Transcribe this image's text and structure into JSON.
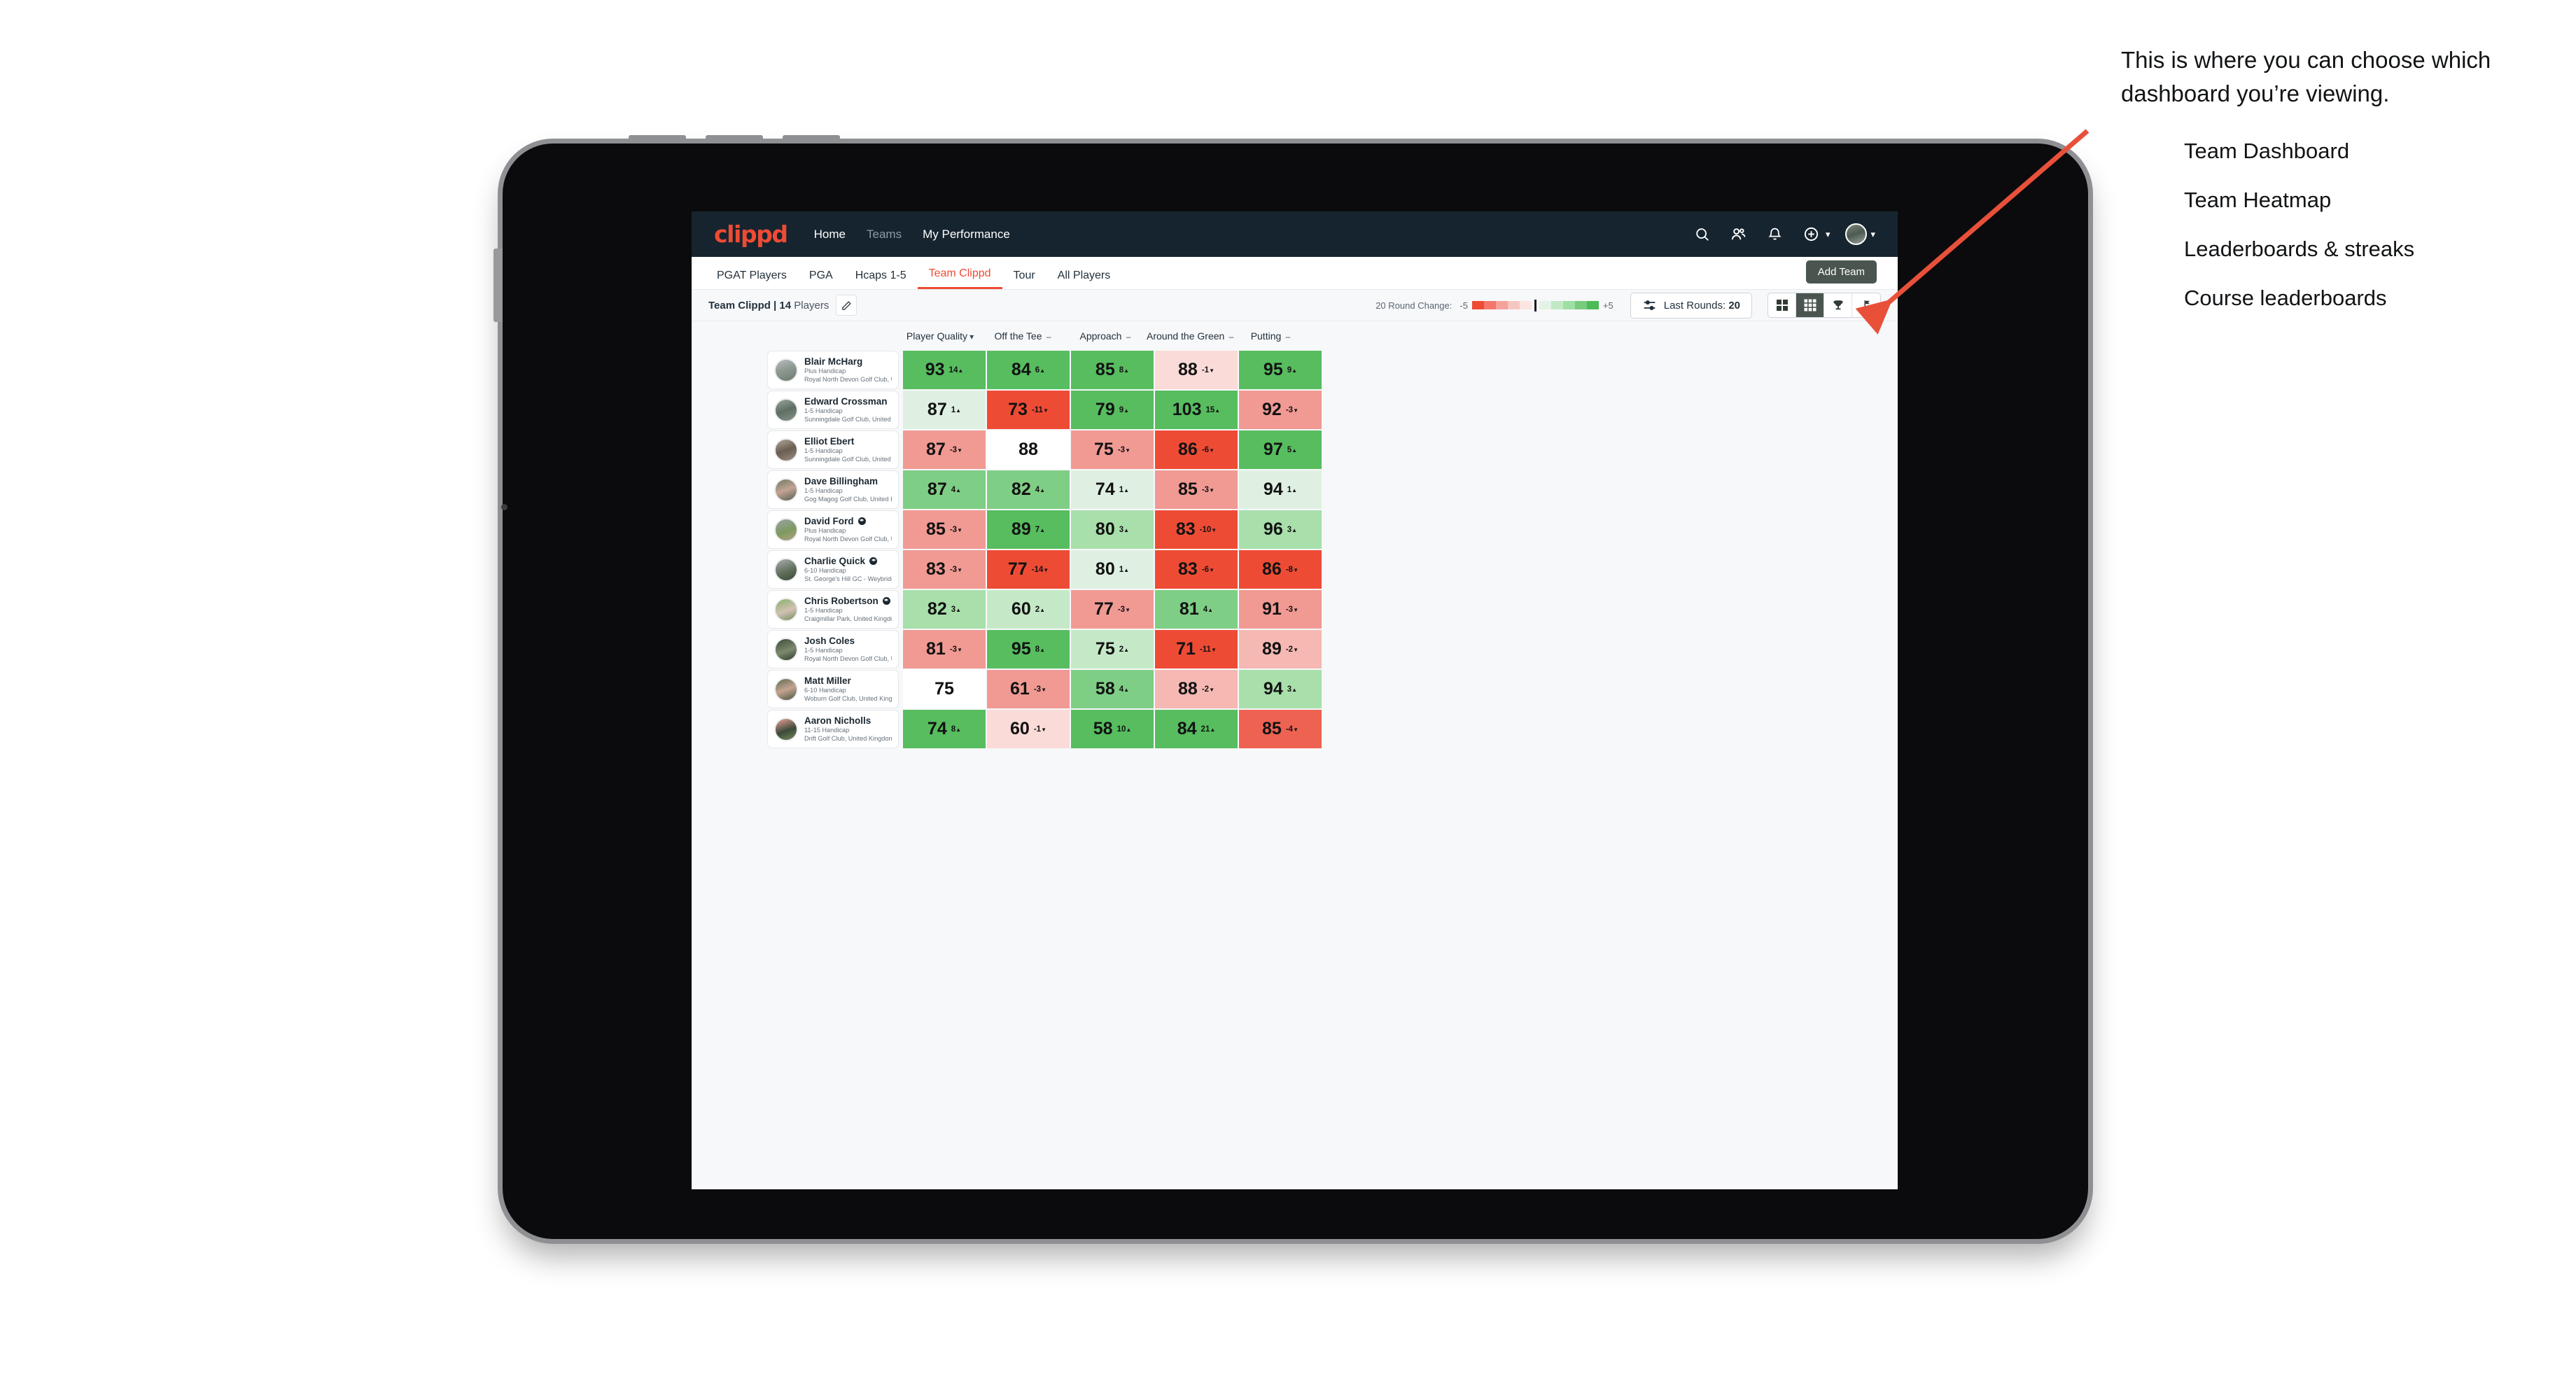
{
  "topnav": {
    "brand": "clippd",
    "links": [
      {
        "label": "Home",
        "muted": false
      },
      {
        "label": "Teams",
        "muted": true
      },
      {
        "label": "My Performance",
        "muted": false
      }
    ],
    "icons": [
      "search-icon",
      "people-icon",
      "bell-icon",
      "plus-circle-icon"
    ]
  },
  "tabs": [
    {
      "label": "PGAT Players",
      "active": false
    },
    {
      "label": "PGA",
      "active": false
    },
    {
      "label": "Hcaps 1-5",
      "active": false
    },
    {
      "label": "Team Clippd",
      "active": true
    },
    {
      "label": "Tour",
      "active": false
    },
    {
      "label": "All Players",
      "active": false
    }
  ],
  "add_team_label": "Add Team",
  "toolbar": {
    "team_name": "Team Clippd | 14",
    "team_players_word": "Players",
    "legend_label": "20 Round Change:",
    "legend_min": "-5",
    "legend_max": "+5",
    "last_rounds_prefix": "Last Rounds:",
    "last_rounds_value": "20",
    "view_buttons": [
      {
        "name": "grid-4-view",
        "active": false
      },
      {
        "name": "grid-9-view",
        "active": true
      },
      {
        "name": "trophy-view",
        "active": false
      },
      {
        "name": "golf-flag-view",
        "active": false
      }
    ]
  },
  "columns": [
    {
      "label": "Player Quality",
      "marker": "⌄"
    },
    {
      "label": "Off the Tee",
      "marker": "–"
    },
    {
      "label": "Approach",
      "marker": "–"
    },
    {
      "label": "Around the Green",
      "marker": "–"
    },
    {
      "label": "Putting",
      "marker": "–"
    }
  ],
  "colors": {
    "brand": "#ee4b35",
    "navy": "#16242f",
    "dark_green": "#4b554f",
    "strong_green": "#57bd5f",
    "strong_red": "#ee4b35",
    "annotation_arrow": "#e8503a"
  },
  "chart_data": {
    "type": "heatmap",
    "title": "Team Clippd | 14 Players",
    "columns": [
      "Player Quality",
      "Off the Tee",
      "Approach",
      "Around the Green",
      "Putting"
    ],
    "rows": [
      "Blair McHarg",
      "Edward Crossman",
      "Elliot Ebert",
      "Dave Billingham",
      "David Ford",
      "Charlie Quick",
      "Chris Robertson",
      "Josh Coles",
      "Matt Miller",
      "Aaron Nicholls"
    ],
    "legend": {
      "label": "20 Round Change:",
      "min": -5,
      "max": 5
    },
    "values": [
      [
        93,
        84,
        85,
        88,
        95
      ],
      [
        87,
        73,
        79,
        103,
        92
      ],
      [
        87,
        88,
        75,
        86,
        97
      ],
      [
        87,
        82,
        74,
        85,
        94
      ],
      [
        85,
        89,
        80,
        83,
        96
      ],
      [
        83,
        77,
        80,
        83,
        86
      ],
      [
        82,
        60,
        77,
        81,
        91
      ],
      [
        81,
        95,
        75,
        71,
        89
      ],
      [
        75,
        61,
        58,
        88,
        94
      ],
      [
        74,
        60,
        58,
        84,
        85
      ]
    ],
    "deltas": [
      [
        14,
        6,
        8,
        -1,
        9
      ],
      [
        1,
        -11,
        9,
        15,
        -3
      ],
      [
        -3,
        null,
        -3,
        -6,
        5
      ],
      [
        4,
        4,
        1,
        -3,
        1
      ],
      [
        -3,
        7,
        3,
        -10,
        3
      ],
      [
        -3,
        -14,
        1,
        -6,
        -8
      ],
      [
        3,
        2,
        -3,
        4,
        -3
      ],
      [
        -3,
        8,
        2,
        -11,
        -2
      ],
      [
        null,
        -3,
        4,
        -2,
        3
      ],
      [
        8,
        -1,
        10,
        21,
        -4
      ]
    ]
  },
  "players": [
    {
      "name": "Blair McHarg",
      "badge": false,
      "handicap": "Plus Handicap",
      "club": "Royal North Devon Golf Club, United Kingdom",
      "avatar": "linear-gradient(160deg,#b9bfc2 0%,#8f9a92 45%,#6d7a70 100%)",
      "cells": [
        {
          "value": "93",
          "delta": "14",
          "dir": "up",
          "bg": "#57bd5f"
        },
        {
          "value": "84",
          "delta": "6",
          "dir": "up",
          "bg": "#57bd5f"
        },
        {
          "value": "85",
          "delta": "8",
          "dir": "up",
          "bg": "#57bd5f"
        },
        {
          "value": "88",
          "delta": "-1",
          "dir": "down",
          "bg": "#fadbd8"
        },
        {
          "value": "95",
          "delta": "9",
          "dir": "up",
          "bg": "#57bd5f"
        }
      ]
    },
    {
      "name": "Edward Crossman",
      "badge": false,
      "handicap": "1-5 Handicap",
      "club": "Sunningdale Golf Club, United Kingdom",
      "avatar": "linear-gradient(160deg,#9aa9a0 0%,#5f6e63 50%,#87928a 100%)",
      "cells": [
        {
          "value": "87",
          "delta": "1",
          "dir": "up",
          "bg": "#dff0e2"
        },
        {
          "value": "73",
          "delta": "-11",
          "dir": "down",
          "bg": "#ee4b35"
        },
        {
          "value": "79",
          "delta": "9",
          "dir": "up",
          "bg": "#57bd5f"
        },
        {
          "value": "103",
          "delta": "15",
          "dir": "up",
          "bg": "#57bd5f"
        },
        {
          "value": "92",
          "delta": "-3",
          "dir": "down",
          "bg": "#f09a93"
        }
      ]
    },
    {
      "name": "Elliot Ebert",
      "badge": false,
      "handicap": "1-5 Handicap",
      "club": "Sunningdale Golf Club, United Kingdom",
      "avatar": "linear-gradient(160deg,#b4a79a 0%,#6a5d52 50%,#9d8f80 100%)",
      "cells": [
        {
          "value": "87",
          "delta": "-3",
          "dir": "down",
          "bg": "#f09a93"
        },
        {
          "value": "88",
          "delta": "",
          "dir": "",
          "bg": "#ffffff"
        },
        {
          "value": "75",
          "delta": "-3",
          "dir": "down",
          "bg": "#f09a93"
        },
        {
          "value": "86",
          "delta": "-6",
          "dir": "down",
          "bg": "#ee4b35"
        },
        {
          "value": "97",
          "delta": "5",
          "dir": "up",
          "bg": "#57bd5f"
        }
      ]
    },
    {
      "name": "Dave Billingham",
      "badge": false,
      "handicap": "1-5 Handicap",
      "club": "Gog Magog Golf Club, United Kingdom",
      "avatar": "linear-gradient(160deg,#6e7a62 0%,#c3a394 50%,#55604f 100%)",
      "cells": [
        {
          "value": "87",
          "delta": "4",
          "dir": "up",
          "bg": "#7fce85"
        },
        {
          "value": "82",
          "delta": "4",
          "dir": "up",
          "bg": "#7fce85"
        },
        {
          "value": "74",
          "delta": "1",
          "dir": "up",
          "bg": "#dff0e2"
        },
        {
          "value": "85",
          "delta": "-3",
          "dir": "down",
          "bg": "#f09a93"
        },
        {
          "value": "94",
          "delta": "1",
          "dir": "up",
          "bg": "#dff0e2"
        }
      ]
    },
    {
      "name": "David Ford",
      "badge": true,
      "handicap": "Plus Handicap",
      "club": "Royal North Devon Golf Club, United Kingdom",
      "avatar": "linear-gradient(160deg,#9aa3a8 0%,#7d9a5f 55%,#b5a082 100%)",
      "cells": [
        {
          "value": "85",
          "delta": "-3",
          "dir": "down",
          "bg": "#f09a93"
        },
        {
          "value": "89",
          "delta": "7",
          "dir": "up",
          "bg": "#57bd5f"
        },
        {
          "value": "80",
          "delta": "3",
          "dir": "up",
          "bg": "#a8dfab"
        },
        {
          "value": "83",
          "delta": "-10",
          "dir": "down",
          "bg": "#ee4b35"
        },
        {
          "value": "96",
          "delta": "3",
          "dir": "up",
          "bg": "#a8dfab"
        }
      ]
    },
    {
      "name": "Charlie Quick",
      "badge": true,
      "handicap": "6-10 Handicap",
      "club": "St. George's Hill GC - Weybridge - Surrey, Uni...",
      "avatar": "linear-gradient(160deg,#a9aeb1 0%,#5c6b56 60%,#3f4a3c 100%)",
      "cells": [
        {
          "value": "83",
          "delta": "-3",
          "dir": "down",
          "bg": "#f09a93"
        },
        {
          "value": "77",
          "delta": "-14",
          "dir": "down",
          "bg": "#ee4b35"
        },
        {
          "value": "80",
          "delta": "1",
          "dir": "up",
          "bg": "#dff0e2"
        },
        {
          "value": "83",
          "delta": "-6",
          "dir": "down",
          "bg": "#ee4b35"
        },
        {
          "value": "86",
          "delta": "-8",
          "dir": "down",
          "bg": "#ee4b35"
        }
      ]
    },
    {
      "name": "Chris Robertson",
      "badge": true,
      "handicap": "1-5 Handicap",
      "club": "Craigmillar Park, United Kingdom",
      "avatar": "linear-gradient(160deg,#86b168 0%,#d3c1b4 55%,#6e8f58 100%)",
      "cells": [
        {
          "value": "82",
          "delta": "3",
          "dir": "up",
          "bg": "#a8dfab"
        },
        {
          "value": "60",
          "delta": "2",
          "dir": "up",
          "bg": "#c5e9c7"
        },
        {
          "value": "77",
          "delta": "-3",
          "dir": "down",
          "bg": "#f09a93"
        },
        {
          "value": "81",
          "delta": "4",
          "dir": "up",
          "bg": "#7fce85"
        },
        {
          "value": "91",
          "delta": "-3",
          "dir": "down",
          "bg": "#f09a93"
        }
      ]
    },
    {
      "name": "Josh Coles",
      "badge": false,
      "handicap": "1-5 Handicap",
      "club": "Royal North Devon Golf Club, United Kingdom",
      "avatar": "linear-gradient(160deg,#3e4a3a 0%,#7d8a6d 55%,#2f3a2c 100%)",
      "cells": [
        {
          "value": "81",
          "delta": "-3",
          "dir": "down",
          "bg": "#f09a93"
        },
        {
          "value": "95",
          "delta": "8",
          "dir": "up",
          "bg": "#57bd5f"
        },
        {
          "value": "75",
          "delta": "2",
          "dir": "up",
          "bg": "#c5e9c7"
        },
        {
          "value": "71",
          "delta": "-11",
          "dir": "down",
          "bg": "#ee4b35"
        },
        {
          "value": "89",
          "delta": "-2",
          "dir": "down",
          "bg": "#f5b8b2"
        }
      ]
    },
    {
      "name": "Matt Miller",
      "badge": false,
      "handicap": "6-10 Handicap",
      "club": "Woburn Golf Club, United Kingdom",
      "avatar": "linear-gradient(160deg,#5d6b4f 0%,#c4a491 50%,#48563f 100%)",
      "cells": [
        {
          "value": "75",
          "delta": "",
          "dir": "",
          "bg": "#ffffff"
        },
        {
          "value": "61",
          "delta": "-3",
          "dir": "down",
          "bg": "#f09a93"
        },
        {
          "value": "58",
          "delta": "4",
          "dir": "up",
          "bg": "#7fce85"
        },
        {
          "value": "88",
          "delta": "-2",
          "dir": "down",
          "bg": "#f5b8b2"
        },
        {
          "value": "94",
          "delta": "3",
          "dir": "up",
          "bg": "#a8dfab"
        }
      ]
    },
    {
      "name": "Aaron Nicholls",
      "badge": false,
      "handicap": "11-15 Handicap",
      "club": "Drift Golf Club, United Kingdom",
      "avatar": "linear-gradient(160deg,#f0a39a 0%,#3c4a38 55%,#768a5c 100%)",
      "cells": [
        {
          "value": "74",
          "delta": "8",
          "dir": "up",
          "bg": "#57bd5f"
        },
        {
          "value": "60",
          "delta": "-1",
          "dir": "down",
          "bg": "#fadbd8"
        },
        {
          "value": "58",
          "delta": "10",
          "dir": "up",
          "bg": "#57bd5f"
        },
        {
          "value": "84",
          "delta": "21",
          "dir": "up",
          "bg": "#57bd5f"
        },
        {
          "value": "85",
          "delta": "-4",
          "dir": "down",
          "bg": "#ee6252"
        }
      ]
    }
  ],
  "annotation": {
    "paragraph": "This is where you can choose which dashboard you’re viewing.",
    "items": [
      "Team Dashboard",
      "Team Heatmap",
      "Leaderboards & streaks",
      "Course leaderboards"
    ]
  }
}
